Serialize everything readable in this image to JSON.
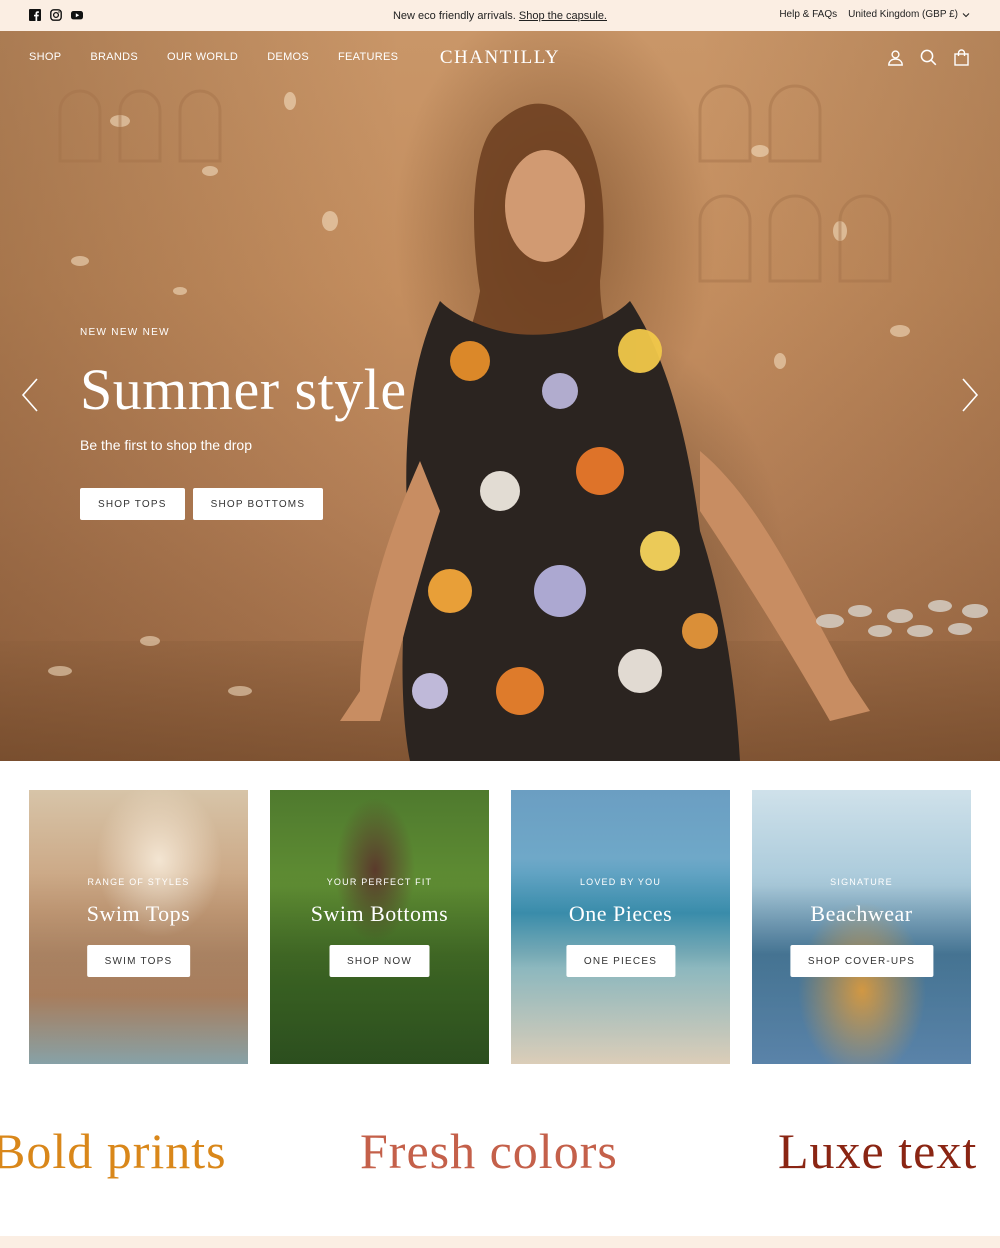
{
  "announcement": {
    "message": "New eco friendly arrivals.",
    "link": "Shop the capsule.",
    "help": "Help & FAQs",
    "currency": "United Kingdom (GBP £)",
    "social": [
      "facebook-icon",
      "instagram-icon",
      "youtube-icon"
    ]
  },
  "header": {
    "logo": "CHANTILLY",
    "nav": [
      "SHOP",
      "BRANDS",
      "OUR WORLD",
      "DEMOS",
      "FEATURES"
    ],
    "icons": [
      "account-icon",
      "search-icon",
      "cart-icon"
    ]
  },
  "hero": {
    "eyebrow": "NEW NEW NEW",
    "headline": "Summer style",
    "subline": "Be the first to shop the drop",
    "buttons": [
      "SHOP TOPS",
      "SHOP BOTTOMS"
    ]
  },
  "cards": [
    {
      "eyebrow": "RANGE OF STYLES",
      "title": "Swim Tops",
      "button": "SWIM TOPS"
    },
    {
      "eyebrow": "YOUR PERFECT FIT",
      "title": "Swim Bottoms",
      "button": "SHOP NOW"
    },
    {
      "eyebrow": "LOVED BY YOU",
      "title": "One Pieces",
      "button": "ONE PIECES"
    },
    {
      "eyebrow": "SIGNATURE",
      "title": "Beachwear",
      "button": "SHOP COVER-UPS"
    }
  ],
  "marquee": [
    "Bold prints",
    "Fresh colors",
    "Luxe text"
  ],
  "colors": {
    "announcement_bg": "#fbeee3",
    "marquee_1": "#d9871a",
    "marquee_2": "#c4604a",
    "marquee_3": "#8a2513"
  }
}
